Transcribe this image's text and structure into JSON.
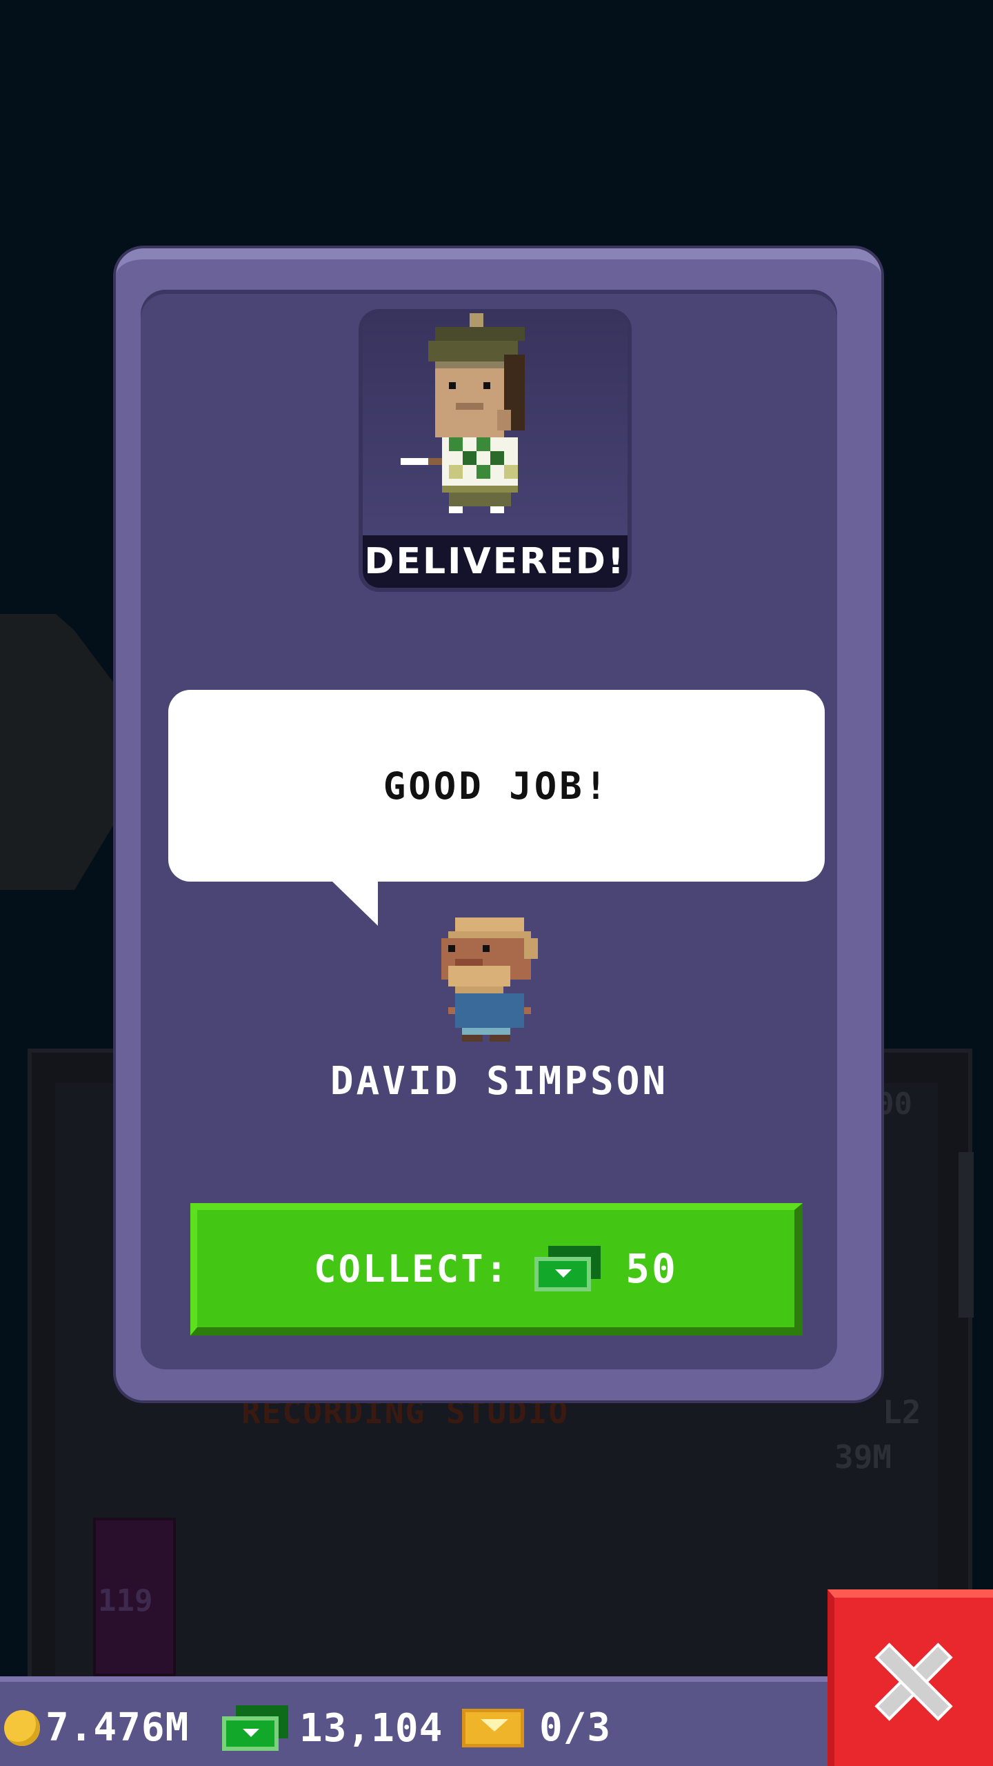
{
  "modal": {
    "status_banner": "DELIVERED!",
    "speech": "GOOD JOB!",
    "speaker_name": "DAVID SIMPSON",
    "collect": {
      "label": "COLLECT:",
      "amount": "50",
      "currency_icon": "bux-icon"
    }
  },
  "background": {
    "floor_name": "RECORDING STUDIO",
    "floor_level": "L2",
    "floor_price": "39M",
    "top_floor_value": "00",
    "elevator_number": "119"
  },
  "status_bar": {
    "coins": "7.476M",
    "bux": "13,104",
    "tickets": "0/3"
  },
  "colors": {
    "modal_frame": "#6a6298",
    "modal_inner": "#4a4574",
    "collect_button": "#44c614",
    "close_button": "#e8282c"
  }
}
